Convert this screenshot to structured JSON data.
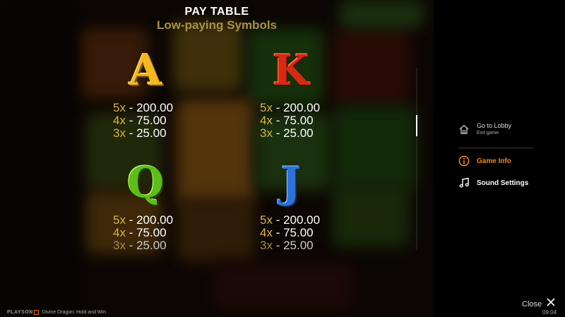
{
  "paytable": {
    "title": "PAY TABLE",
    "subtitle": "Low-paying Symbols",
    "symbols": [
      {
        "letter": "A",
        "color": "#f2b820",
        "pays": [
          {
            "mult": "5x",
            "value": "- 200.00"
          },
          {
            "mult": "4x",
            "value": "- 75.00"
          },
          {
            "mult": "3x",
            "value": "- 25.00"
          }
        ]
      },
      {
        "letter": "K",
        "color": "#d62a12",
        "pays": [
          {
            "mult": "5x",
            "value": "- 200.00"
          },
          {
            "mult": "4x",
            "value": "- 75.00"
          },
          {
            "mult": "3x",
            "value": "- 25.00"
          }
        ]
      },
      {
        "letter": "Q",
        "color": "#5ebd1a",
        "pays": [
          {
            "mult": "5x",
            "value": "- 200.00"
          },
          {
            "mult": "4x",
            "value": "- 75.00"
          },
          {
            "mult": "3x",
            "value": "- 25.00"
          }
        ]
      },
      {
        "letter": "J",
        "color": "#2f72d6",
        "pays": [
          {
            "mult": "5x",
            "value": "- 200.00"
          },
          {
            "mult": "4x",
            "value": "- 75.00"
          },
          {
            "mult": "3x",
            "value": "- 25.00"
          }
        ]
      }
    ]
  },
  "menu": {
    "lobby": {
      "title": "Go to Lobby",
      "subtitle": "Exit game",
      "icon": "home-icon"
    },
    "info": {
      "label": "Game Info",
      "icon": "info-icon",
      "color": "#f28c1e"
    },
    "sound": {
      "label": "Sound Settings",
      "icon": "music-note-icon"
    }
  },
  "close_label": "Close",
  "clock": "09:04",
  "footer": {
    "brand": "PLAYSON",
    "game_name": "Divine Dragon: Hold and Win"
  }
}
